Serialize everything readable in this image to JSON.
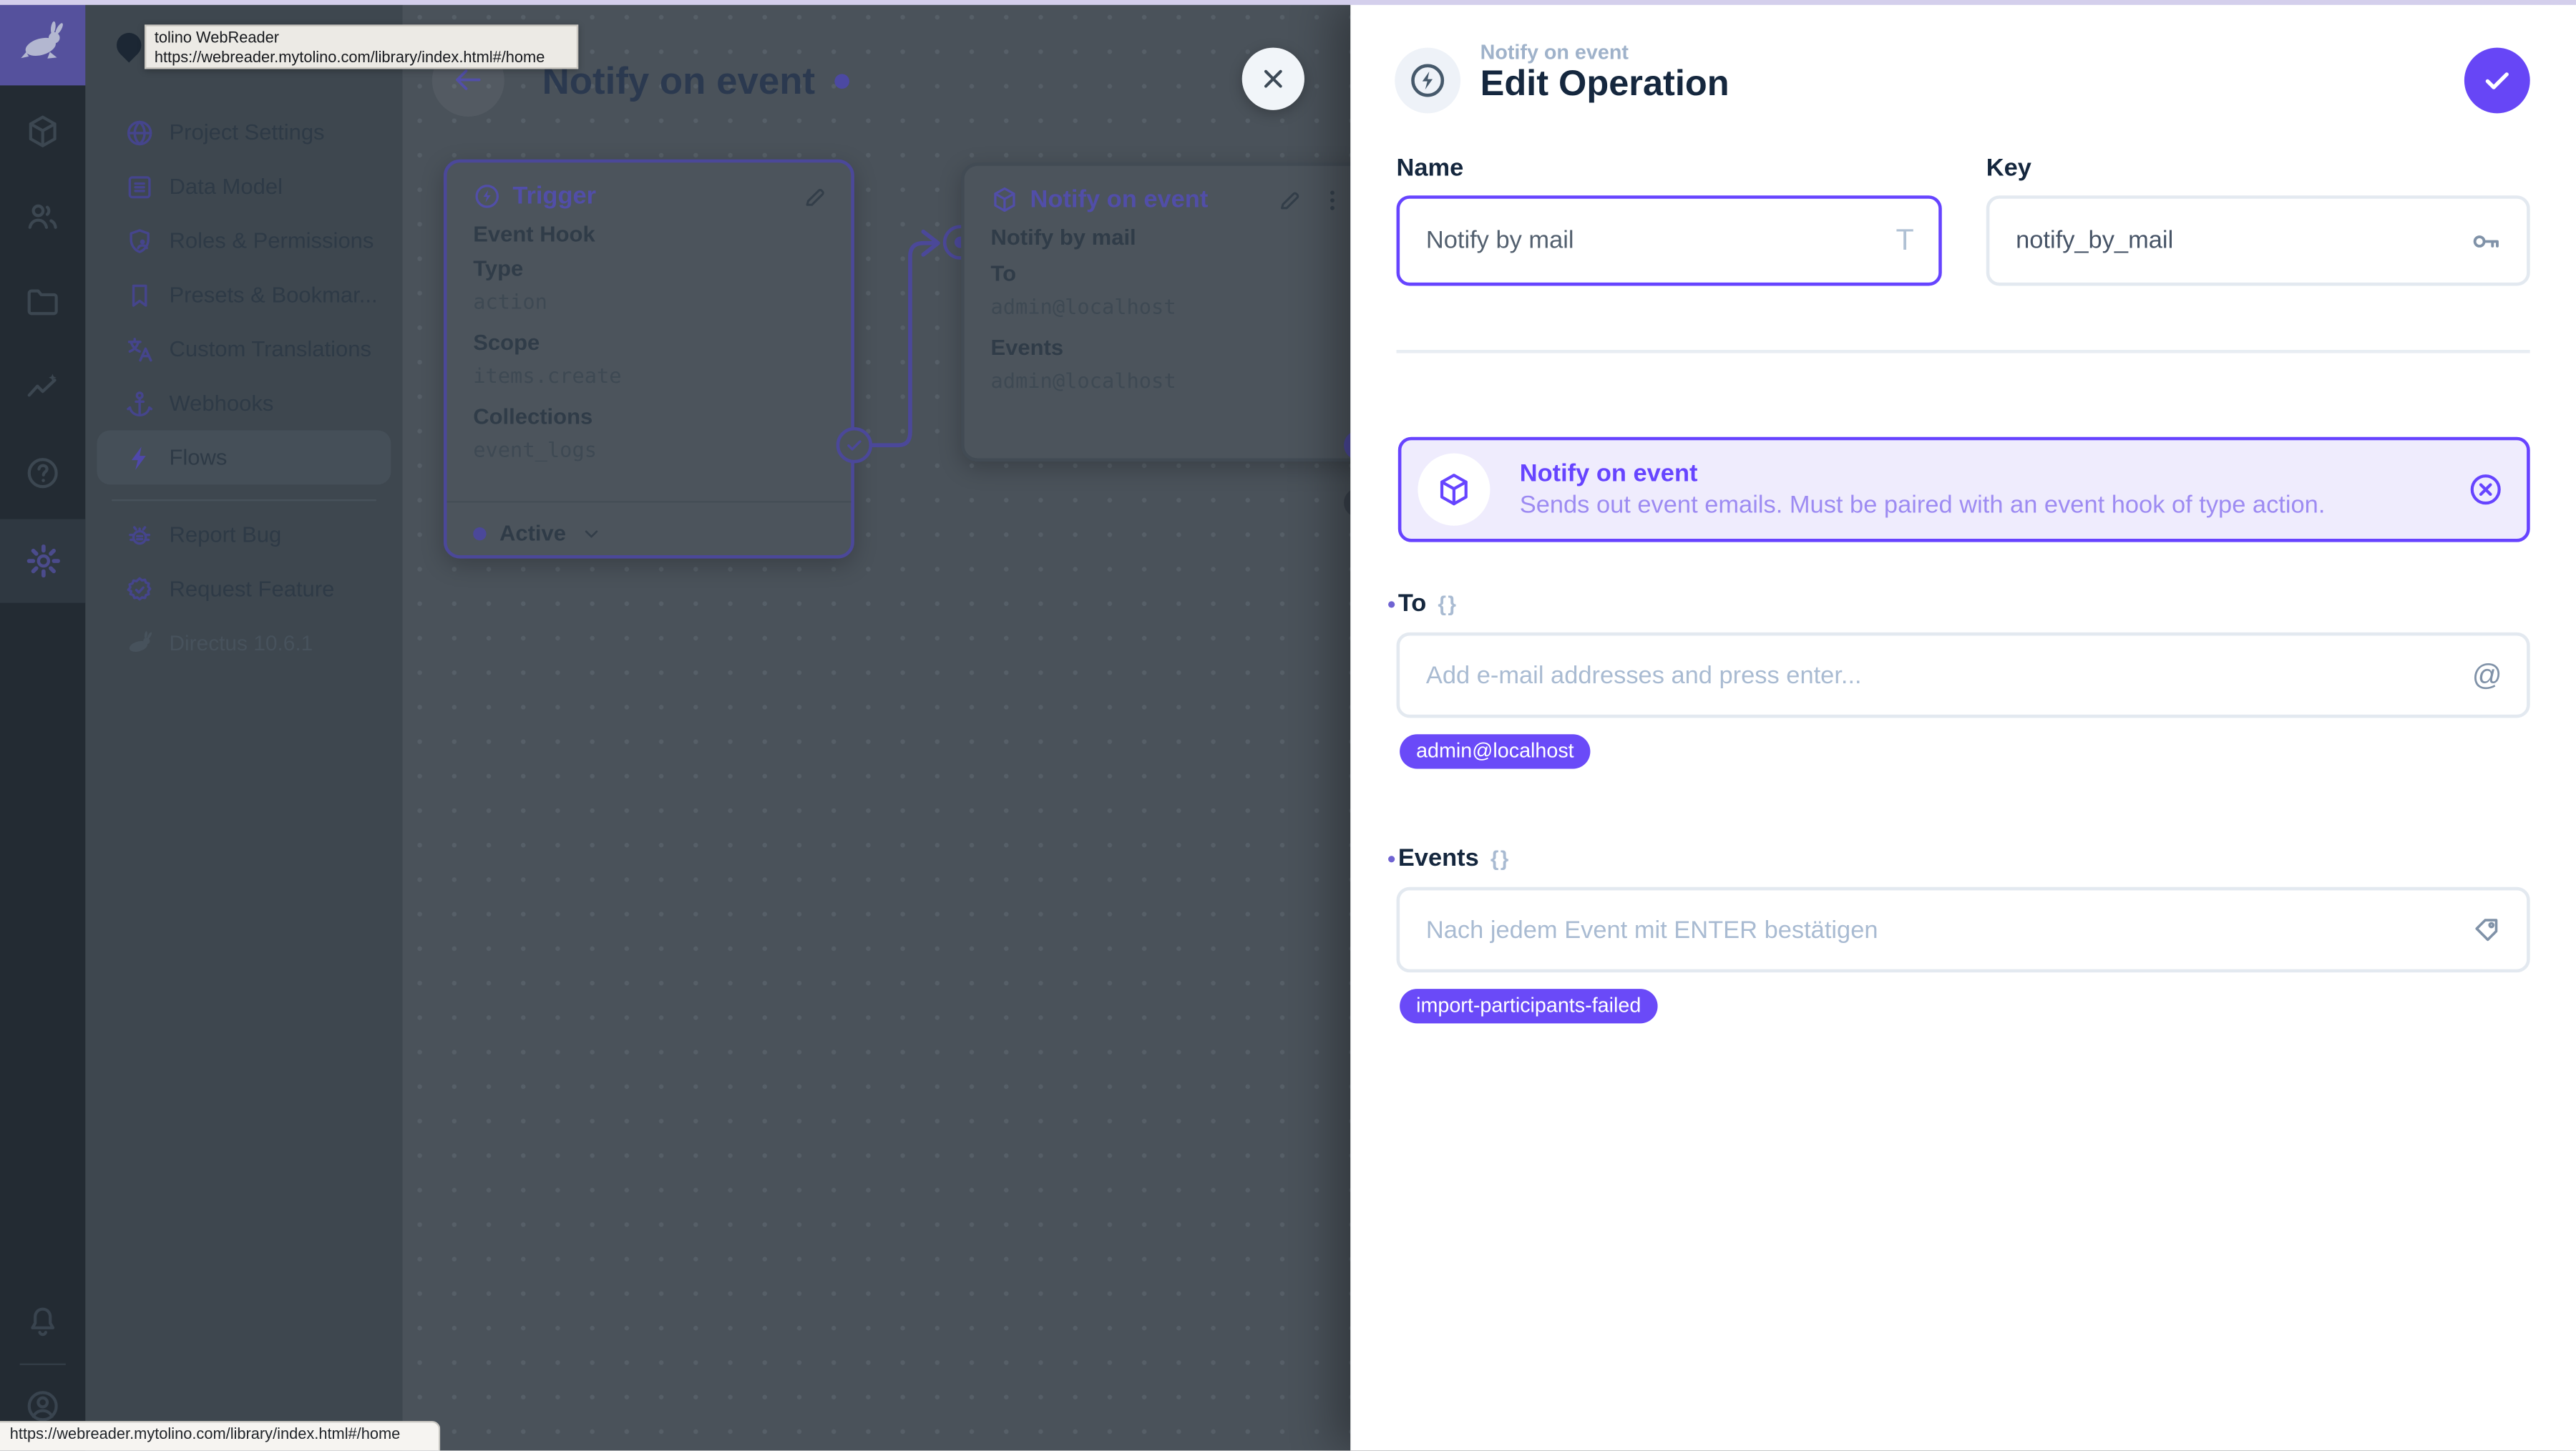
{
  "colors": {
    "accent": "#6644FF",
    "accent_dim": "#4B4899",
    "chip_bg": "#6A4AF8",
    "save_btn": "#6746F6"
  },
  "browser": {
    "tooltip_title": "tolino WebReader",
    "tooltip_url": "https://webreader.mytolino.com/library/index.html#/home",
    "status_url": "https://webreader.mytolino.com/library/index.html#/home"
  },
  "icons": {
    "braces": "{}",
    "at": "@",
    "title_affix": "T"
  },
  "module_bar": {
    "modules": [
      "content",
      "user-directory",
      "file-library",
      "insights",
      "documentation",
      "settings",
      "notifications",
      "account"
    ]
  },
  "nav": {
    "items": [
      {
        "label": "Project Settings"
      },
      {
        "label": "Data Model"
      },
      {
        "label": "Roles & Permissions"
      },
      {
        "label": "Presets & Bookmar..."
      },
      {
        "label": "Custom Translations"
      },
      {
        "label": "Webhooks"
      },
      {
        "label": "Flows"
      }
    ],
    "footer": [
      {
        "label": "Report Bug"
      },
      {
        "label": "Request Feature"
      }
    ],
    "version": "Directus 10.6.1"
  },
  "flow": {
    "title": "Notify on event",
    "trigger": {
      "title": "Trigger",
      "subtitle": "Event Hook",
      "rows": [
        {
          "label": "Type",
          "value": "action"
        },
        {
          "label": "Scope",
          "value": "items.create"
        },
        {
          "label": "Collections",
          "value": "event_logs"
        }
      ],
      "status": "Active"
    },
    "operation": {
      "title": "Notify on event",
      "name": "Notify by mail",
      "rows": [
        {
          "label": "To",
          "value": "admin@localhost"
        },
        {
          "label": "Events",
          "value": "admin@localhost"
        }
      ]
    }
  },
  "drawer": {
    "breadcrumb": "Notify on event",
    "title": "Edit Operation",
    "name_field": {
      "label": "Name",
      "value": "Notify by mail"
    },
    "key_field": {
      "label": "Key",
      "value": "notify_by_mail"
    },
    "notice": {
      "title": "Notify on event",
      "description": "Sends out event emails. Must be paired with an event hook of type action."
    },
    "to_field": {
      "label": "To",
      "placeholder": "Add e-mail addresses and press enter...",
      "chip": "admin@localhost"
    },
    "events_field": {
      "label": "Events",
      "placeholder": "Nach jedem Event mit ENTER bestätigen",
      "chip": "import-participants-failed"
    }
  }
}
